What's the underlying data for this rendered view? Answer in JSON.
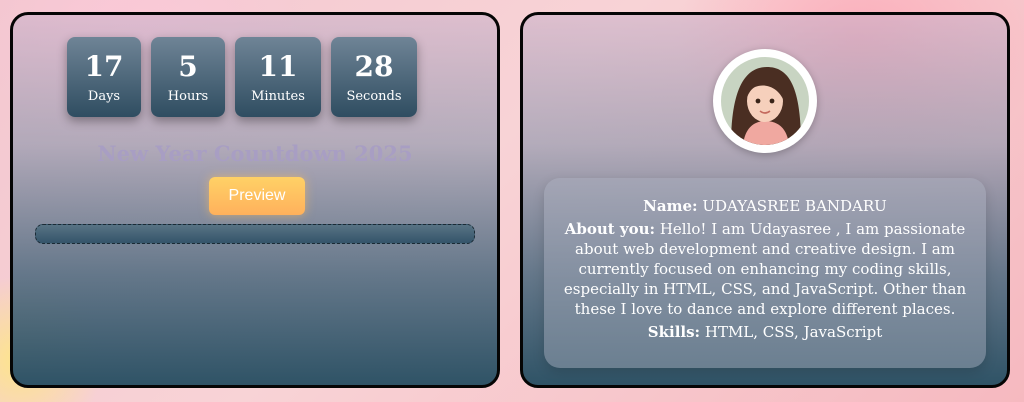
{
  "countdown": {
    "units": [
      {
        "value": "17",
        "label": "Days"
      },
      {
        "value": "5",
        "label": "Hours"
      },
      {
        "value": "11",
        "label": "Minutes"
      },
      {
        "value": "28",
        "label": "Seconds"
      }
    ],
    "title": "New Year Countdown 2025",
    "preview_label": "Preview",
    "progress": 0
  },
  "profile": {
    "avatar_icon": "avatar-icon",
    "name_label": "Name:",
    "name": "UDAYASREE BANDARU",
    "about_label": "About you:",
    "about": "Hello! I am Udayasree , I am passionate about web development and creative design. I am currently focused on enhancing my coding skills, especially in HTML, CSS, and JavaScript. Other than these I love to dance and explore different places.",
    "skills_label": "Skills:",
    "skills": "HTML, CSS, JavaScript"
  },
  "colors": {
    "button": "#ffc26a",
    "title": "#a89ec3",
    "timer_box": "#2f4d61"
  }
}
